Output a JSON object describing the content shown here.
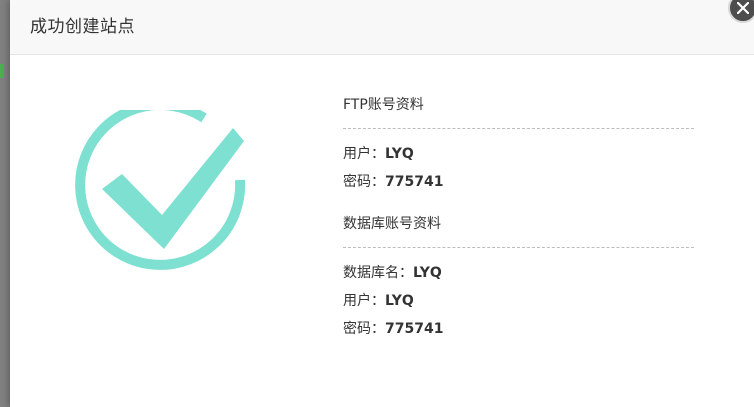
{
  "dialog": {
    "title": "成功创建站点"
  },
  "ftp": {
    "title": "FTP账号资料",
    "user_label": "用户：",
    "user_value": "LYQ",
    "password_label": "密码：",
    "password_value": "775741"
  },
  "database": {
    "title": "数据库账号资料",
    "name_label": "数据库名：",
    "name_value": "LYQ",
    "user_label": "用户：",
    "user_value": "LYQ",
    "password_label": "密码：",
    "password_value": "775741"
  },
  "icons": {
    "success": "check-circle-icon",
    "close": "close-icon"
  },
  "colors": {
    "success_accent": "#7de0d0",
    "header_bg": "#f8f8f8",
    "text": "#333333"
  }
}
